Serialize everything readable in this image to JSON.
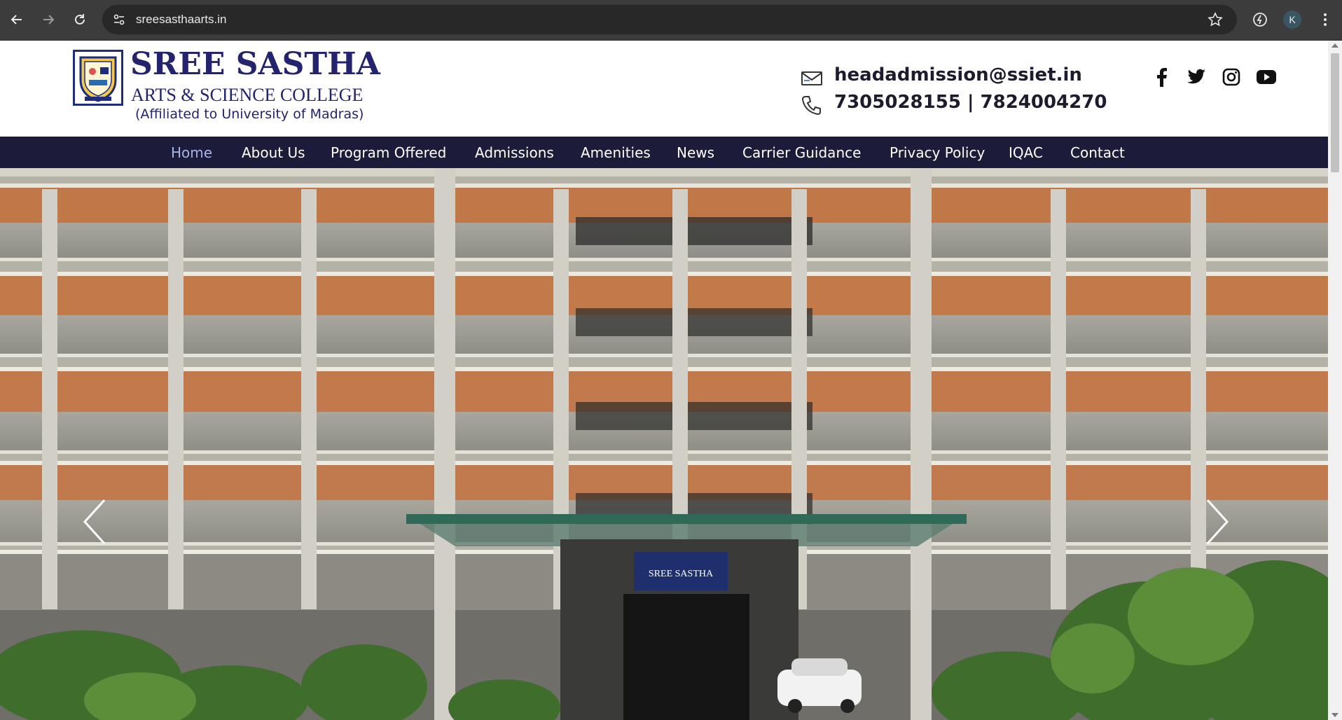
{
  "browser": {
    "url": "sreesasthaarts.in",
    "profile_initial": "K",
    "icons": [
      "back-icon",
      "forward-icon",
      "reload-icon",
      "site-info-icon",
      "bookmark-star-icon",
      "extension-icon",
      "menu-dots-icon"
    ]
  },
  "header": {
    "brand_title": "SREE SASTHA",
    "brand_subtitle": "ARTS & SCIENCE COLLEGE",
    "brand_affiliation": "(Affiliated to University of Madras)",
    "email": "headadmission@ssiet.in",
    "phone": "7305028155 | 7824004270",
    "social": [
      "facebook-icon",
      "twitter-icon",
      "instagram-icon",
      "youtube-icon"
    ]
  },
  "nav": {
    "items": [
      "Home",
      "About Us",
      "Program Offered",
      "Admissions",
      "Amenities",
      "News",
      "Carrier Guidance",
      "Privacy Policy",
      "IQAC",
      "Contact"
    ],
    "active": "Home"
  },
  "hero": {
    "sign_text": "SREE SASTHA",
    "controls": [
      "previous-slide-icon",
      "next-slide-icon"
    ]
  },
  "colors": {
    "nav_bg": "#1c1c3a",
    "brand": "#23236e",
    "active_nav": "#aab3e6",
    "chrome_bg": "#3c3c3c"
  }
}
